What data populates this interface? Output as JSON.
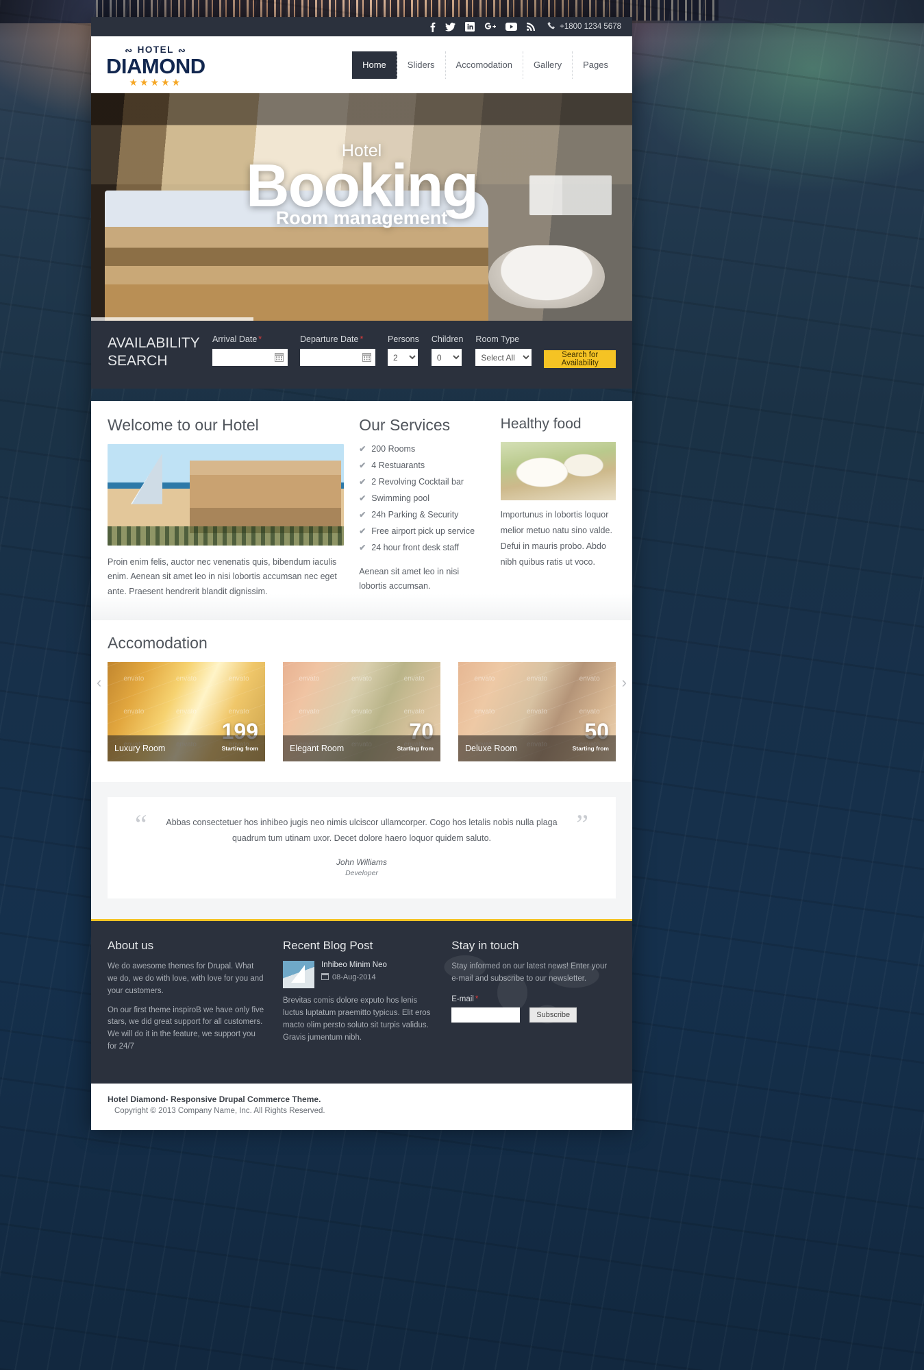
{
  "topbar": {
    "social": [
      {
        "name": "facebook-icon",
        "label": "f"
      },
      {
        "name": "twitter-icon",
        "label": "t"
      },
      {
        "name": "linkedin-icon",
        "label": "in"
      },
      {
        "name": "googleplus-icon",
        "label": "g+"
      },
      {
        "name": "youtube-icon",
        "label": "yt"
      },
      {
        "name": "rss-icon",
        "label": "rss"
      }
    ],
    "phone": "+1800 1234 5678"
  },
  "logo": {
    "top": "HOTEL",
    "main": "DIAMOND",
    "stars": "★★★★★"
  },
  "nav": {
    "items": [
      {
        "label": "Home",
        "active": true
      },
      {
        "label": "Sliders",
        "active": false
      },
      {
        "label": "Accomodation",
        "active": false
      },
      {
        "label": "Gallery",
        "active": false
      },
      {
        "label": "Pages",
        "active": false
      }
    ]
  },
  "hero": {
    "small": "Hotel",
    "big": "Booking",
    "sub": "Room management"
  },
  "search": {
    "title": "AVAILABILITY SEARCH",
    "arrival_label": "Arrival Date",
    "arrival_value": "",
    "arrival_placeholder": "",
    "departure_label": "Departure Date",
    "departure_value": "",
    "departure_placeholder": "",
    "persons_label": "Persons",
    "persons_value": "2",
    "children_label": "Children",
    "children_value": "0",
    "roomtype_label": "Room Type",
    "roomtype_value": "Select All",
    "button": "Search for Availability",
    "required_mark": "*",
    "accent": "#f5c324"
  },
  "welcome": {
    "title": "Welcome to our Hotel",
    "paragraph": "Proin enim felis, auctor nec venenatis quis, bibendum iaculis enim. Aenean sit amet leo in nisi lobortis accumsan nec eget ante. Praesent hendrerit blandit dignissim."
  },
  "services": {
    "title": "Our Services",
    "items": [
      "200 Rooms",
      "4 Restuarants",
      "2 Revolving Cocktail bar",
      "Swimming pool",
      "24h Parking & Security",
      "Free airport pick up service",
      "24 hour front desk staff"
    ],
    "note": "Aenean sit amet leo in nisi lobortis accumsan.",
    "check": "✔"
  },
  "food": {
    "title": "Healthy food",
    "text": "Importunus in lobortis loquor melior metuo natu sino valde. Defui in mauris probo. Abdo nibh quibus ratis ut voco."
  },
  "accomodation": {
    "title": "Accomodation",
    "prev": "‹",
    "next": "›",
    "watermark": "envato",
    "cards": [
      {
        "name": "Luxury Room",
        "price": "199",
        "from": "Starting from"
      },
      {
        "name": "Elegant Room",
        "price": "70",
        "from": "Starting from"
      },
      {
        "name": "Deluxe Room",
        "price": "50",
        "from": "Starting from"
      }
    ]
  },
  "testimonial": {
    "open_quote": "“",
    "close_quote": "”",
    "text": "Abbas consectetuer hos inhibeo jugis neo nimis ulciscor ullamcorper. Cogo hos letalis nobis nulla plaga quadrum tum utinam uxor. Decet dolore haero loquor quidem saluto.",
    "author": "John Williams",
    "role": "Developer"
  },
  "footer": {
    "about": {
      "title": "About us",
      "p1": "We do awesome themes for Drupal. What we do, we do with love, with love for you and your customers.",
      "p2": "On our first theme inspiroB we have only five stars, we did great support for all customers. We will do it in the feature, we support you for 24/7"
    },
    "blog": {
      "title": "Recent Blog Post",
      "post_title": "Inhibeo Minim Neo",
      "post_date": "08-Aug-2014",
      "excerpt": "Brevitas comis dolore exputo hos lenis luctus luptatum praemitto typicus. Elit eros macto olim persto soluto sit turpis validus. Gravis jumentum nibh."
    },
    "touch": {
      "title": "Stay in touch",
      "text": "Stay informed on our latest news! Enter your e-mail and subscribe to our newsletter.",
      "email_label": "E-mail",
      "required_mark": "*",
      "email_value": "",
      "button": "Subscribe"
    }
  },
  "copyright": {
    "brand": "Hotel Diamond- Responsive Drupal Commerce Theme.",
    "text": "Copyright © 2013 Company Name, Inc. All Rights Reserved."
  }
}
